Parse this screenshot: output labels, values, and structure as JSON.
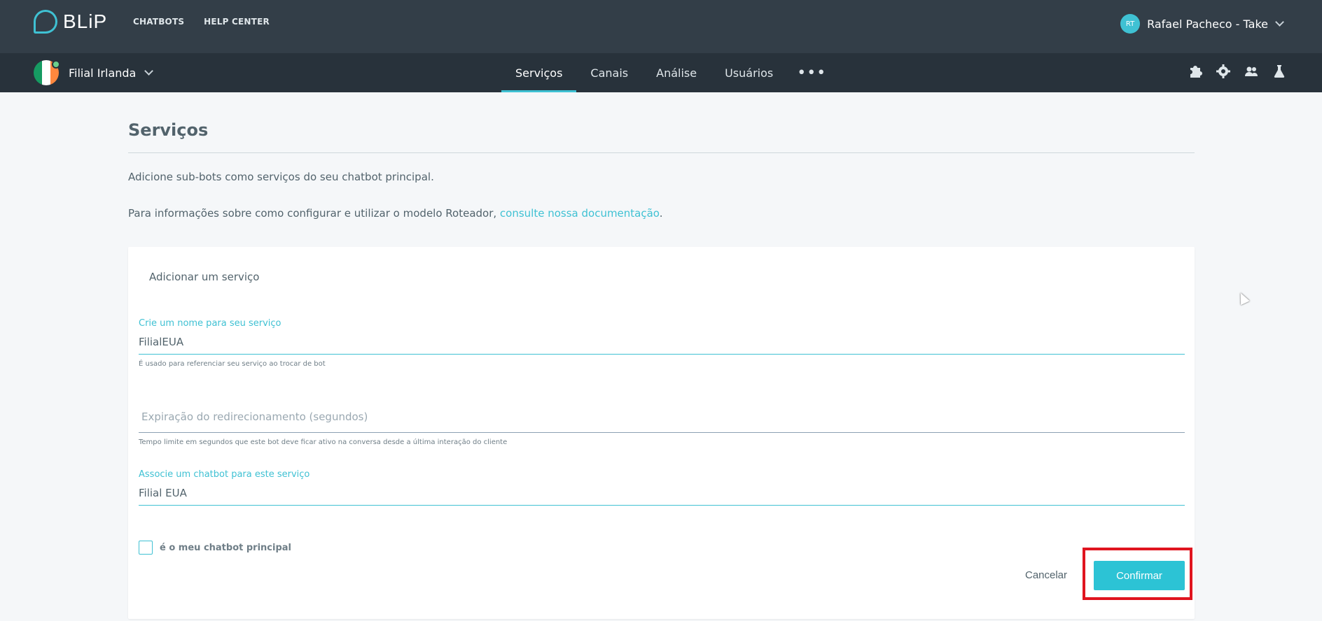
{
  "topbar": {
    "logo_text": "BLiP",
    "nav": [
      "CHATBOTS",
      "HELP CENTER"
    ],
    "user_initials": "RT",
    "user_name": "Rafael Pacheco - Take"
  },
  "subnav": {
    "bot_name": "Filial Irlanda",
    "tabs": [
      "Serviços",
      "Canais",
      "Análise",
      "Usuários"
    ],
    "active_tab": "Serviços",
    "more_label": "•••",
    "tools": [
      "puzzle-icon",
      "gear-icon",
      "users-icon",
      "flask-icon"
    ]
  },
  "page": {
    "title": "Serviços",
    "desc1": "Adicione sub-bots como serviços do seu chatbot principal.",
    "desc2_prefix": "Para informações sobre como configurar e utilizar o modelo Roteador, ",
    "desc2_link": "consulte nossa documentação",
    "desc2_suffix": "."
  },
  "form": {
    "card_title": "Adicionar um serviço",
    "name_label": "Crie um nome para seu serviço",
    "name_value": "FilialEUA",
    "name_help": "É usado para referenciar seu serviço ao trocar de bot",
    "expiration_placeholder": "Expiração do redirecionamento (segundos)",
    "expiration_help": "Tempo limite em segundos que este bot deve ficar ativo na conversa desde a última interação do cliente",
    "chatbot_label": "Associe um chatbot para este serviço",
    "chatbot_value": "Filial EUA",
    "main_checkbox_label": "é o meu chatbot principal",
    "main_checkbox_checked": false,
    "cancel_label": "Cancelar",
    "confirm_label": "Confirmar"
  },
  "colors": {
    "accent": "#3fc1d3",
    "topbar": "#333e48",
    "subnav": "#28323b",
    "highlight": "#e0141f"
  }
}
